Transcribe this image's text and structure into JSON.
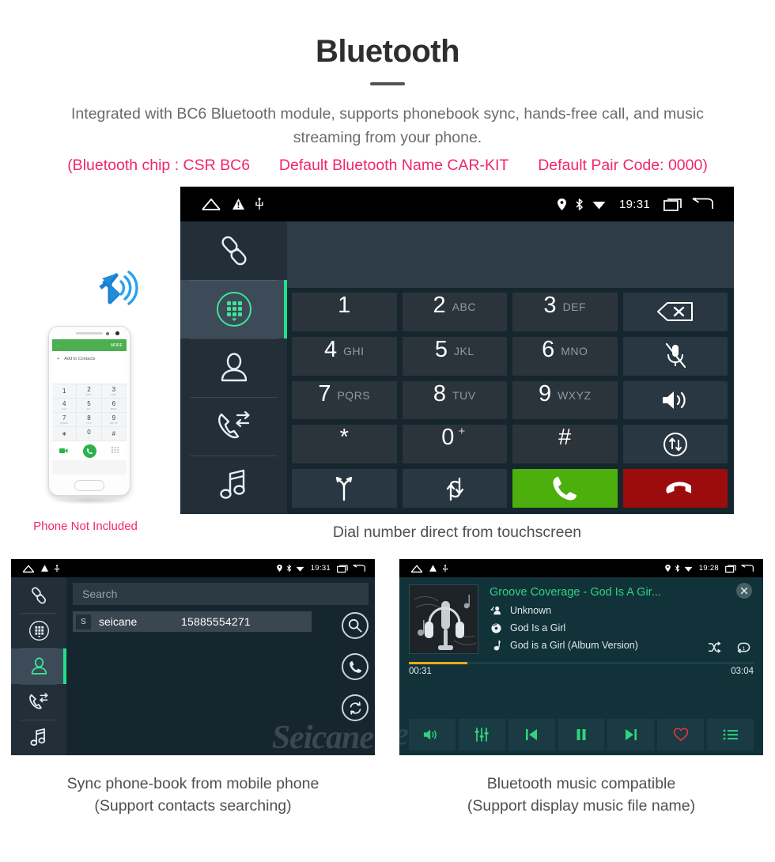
{
  "header": {
    "title": "Bluetooth",
    "subtitle": "Integrated with BC6 Bluetooth module, supports phonebook sync, hands-free call, and music streaming from your phone.",
    "spec_chip": "(Bluetooth chip : CSR BC6",
    "spec_name": "Default Bluetooth Name CAR-KIT",
    "spec_pair": "Default Pair Code: 0000)",
    "accent_pink": "#f2256f",
    "title_color": "#2e2e2e"
  },
  "captions": {
    "main": "Dial number direct from touchscreen",
    "phone_note": "Phone Not Included",
    "left_line1": "Sync phone-book from mobile phone",
    "left_line2": "(Support contacts searching)",
    "right_line1": "Bluetooth music compatible",
    "right_line2": "(Support display music file name)"
  },
  "statusbar": {
    "time_main": "19:31",
    "time_contacts": "19:31",
    "time_music": "19:28",
    "left_icons": [
      "home-icon",
      "warning-icon",
      "usb-icon"
    ],
    "right_icons": [
      "location-icon",
      "bluetooth-icon",
      "wifi-icon"
    ],
    "nav_icons": [
      "recents-icon",
      "back-icon"
    ]
  },
  "sidebar": {
    "items": [
      {
        "icon": "link-pair-icon",
        "name": "pair",
        "active": false
      },
      {
        "icon": "dialpad-icon",
        "name": "dialpad",
        "active": true
      },
      {
        "icon": "contacts-icon",
        "name": "contacts",
        "active": false
      },
      {
        "icon": "call-history-icon",
        "name": "call-history",
        "active": false
      },
      {
        "icon": "music-note-icon",
        "name": "music",
        "active": false
      }
    ],
    "active_color": "#22e08a",
    "bg": "#232f38"
  },
  "dialer": {
    "keys": [
      {
        "num": "1",
        "letters": ""
      },
      {
        "num": "2",
        "letters": "ABC"
      },
      {
        "num": "3",
        "letters": "DEF"
      },
      {
        "num": "4",
        "letters": "GHI"
      },
      {
        "num": "5",
        "letters": "JKL"
      },
      {
        "num": "6",
        "letters": "MNO"
      },
      {
        "num": "7",
        "letters": "PQRS"
      },
      {
        "num": "8",
        "letters": "TUV"
      },
      {
        "num": "9",
        "letters": "WXYZ"
      },
      {
        "num": "0",
        "letters": "",
        "sup": "+"
      },
      {
        "num": "#",
        "letters": ""
      }
    ],
    "star_key": "*",
    "function_keys": [
      "backspace-icon",
      "mute-mic-icon",
      "speaker-icon",
      "transfer-audio-icon",
      "merge-call-icon",
      "swap-call-icon"
    ],
    "call_button": "call-icon",
    "hangup_button": "hangup-icon",
    "call_color": "#4caf0b",
    "hangup_color": "#9c0c0c"
  },
  "contacts": {
    "search_placeholder": "Search",
    "rows": [
      {
        "initial": "S",
        "name": "seicane",
        "number": "15885554271"
      }
    ],
    "actions": [
      "search-icon",
      "call-icon",
      "sync-icon"
    ],
    "watermark": "Seicane"
  },
  "music": {
    "track_title": "Groove Coverage - God Is A Gir...",
    "artist": "Unknown",
    "album": "God Is a Girl",
    "file_name": "God is a Girl (Album Version)",
    "time_elapsed": "00:31",
    "time_total": "03:04",
    "progress_percent": 17,
    "progress_color": "#f0a81d",
    "title_color": "#2fd47e",
    "controls": [
      "volume-icon",
      "equalizer-icon",
      "previous-icon",
      "pause-icon",
      "next-icon",
      "favorite-icon",
      "playlist-icon"
    ],
    "extra_controls": [
      "shuffle-icon",
      "repeat-one-icon"
    ],
    "close_button": "close-icon",
    "album_art": "microphone-headphones-artwork",
    "watermark": "e"
  },
  "phone_mockup": {
    "bt_icon": "bluetooth-signal-icon",
    "appbar_back": "back-arrow-icon",
    "appbar_more": "MORE",
    "add_contacts": "Add to Contacts",
    "keys": [
      {
        "num": "1",
        "sub": ""
      },
      {
        "num": "2",
        "sub": "ABC"
      },
      {
        "num": "3",
        "sub": "DEF"
      },
      {
        "num": "4",
        "sub": "GHI"
      },
      {
        "num": "5",
        "sub": "JKL"
      },
      {
        "num": "6",
        "sub": "MNO"
      },
      {
        "num": "7",
        "sub": "PQRS"
      },
      {
        "num": "8",
        "sub": "TUV"
      },
      {
        "num": "9",
        "sub": "WXYZ"
      },
      {
        "num": "∗",
        "sub": ""
      },
      {
        "num": "0",
        "sub": "+"
      },
      {
        "num": "#",
        "sub": ""
      }
    ],
    "action_left": "video-call-icon",
    "action_center": "call-icon",
    "action_right": "keypad-icon",
    "accent_green": "#4caf50"
  }
}
